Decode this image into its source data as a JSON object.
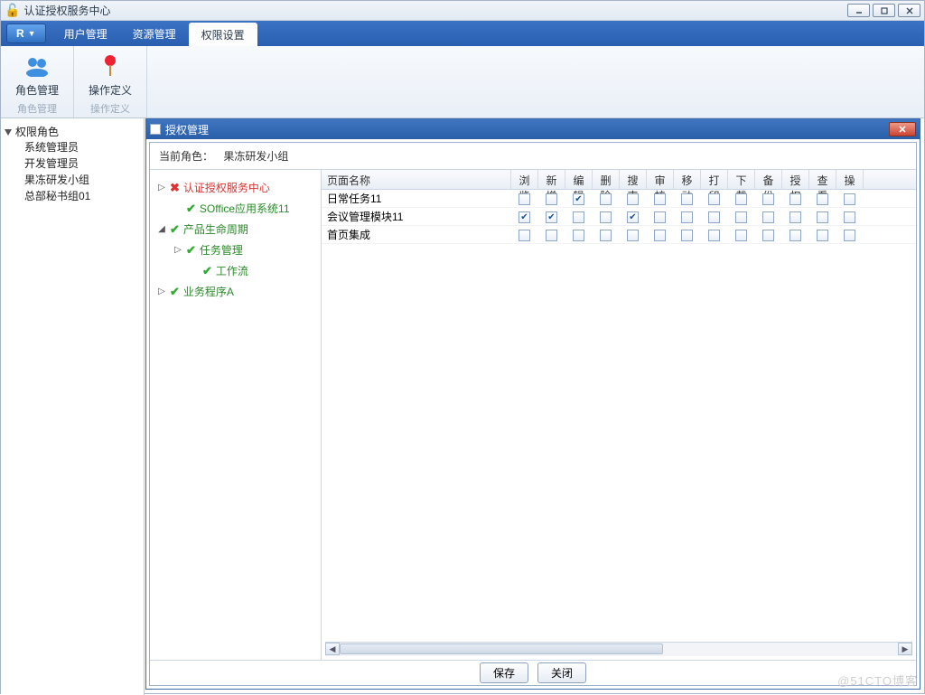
{
  "window": {
    "title": "认证授权服务中心"
  },
  "menu": {
    "r_label": "R",
    "items": [
      "用户管理",
      "资源管理",
      "权限设置"
    ],
    "active_index": 2
  },
  "ribbon": {
    "groups": [
      {
        "button": "角色管理",
        "label": "角色管理",
        "icon": "users"
      },
      {
        "button": "操作定义",
        "label": "操作定义",
        "icon": "pin"
      }
    ]
  },
  "left_tree": {
    "root": "权限角色",
    "children": [
      "系统管理员",
      "开发管理员",
      "果冻研发小组",
      "总部秘书组01"
    ]
  },
  "dialog": {
    "title": "授权管理",
    "current_role_label": "当前角色：",
    "current_role_value": "果冻研发小组",
    "tree": [
      {
        "level": 1,
        "exp": "▷",
        "status": "red",
        "text": "认证授权服务中心"
      },
      {
        "level": 2,
        "exp": "",
        "status": "green",
        "text": "SOffice应用系统11"
      },
      {
        "level": 1,
        "exp": "◢",
        "status": "green",
        "text": "产品生命周期"
      },
      {
        "level": 2,
        "exp": "▷",
        "status": "green",
        "text": "任务管理"
      },
      {
        "level": 3,
        "exp": "",
        "status": "green",
        "text": "工作流"
      },
      {
        "level": 1,
        "exp": "▷",
        "status": "green",
        "text": "业务程序A"
      }
    ],
    "columns": [
      "页面名称",
      "浏览",
      "新增",
      "编辑",
      "删除",
      "搜索",
      "审核",
      "移动",
      "打印",
      "下载",
      "备份",
      "授权",
      "查看",
      "操"
    ],
    "rows": [
      {
        "name": "日常任务11",
        "checks": [
          false,
          false,
          true,
          false,
          false,
          false,
          false,
          false,
          false,
          false,
          false,
          false,
          false
        ]
      },
      {
        "name": "会议管理模块11",
        "checks": [
          true,
          true,
          false,
          false,
          true,
          false,
          false,
          false,
          false,
          false,
          false,
          false,
          false
        ]
      },
      {
        "name": "首页集成",
        "checks": [
          false,
          false,
          false,
          false,
          false,
          false,
          false,
          false,
          false,
          false,
          false,
          false,
          false
        ]
      }
    ],
    "buttons": {
      "save": "保存",
      "close": "关闭"
    }
  },
  "watermark": "@51CTO博客"
}
